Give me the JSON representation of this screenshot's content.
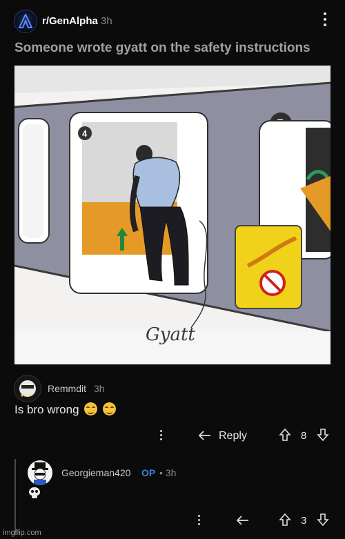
{
  "post": {
    "subreddit": "r/GenAlpha",
    "age": "3h",
    "title": "Someone wrote gyatt on the safety instructions",
    "image_handwriting": "Gyatt",
    "panel_numbers": [
      "4",
      "5"
    ]
  },
  "comments": [
    {
      "author": "Remmdit",
      "age": "3h",
      "body": "Is bro wrong",
      "emojis": [
        "relieved-face",
        "relieved-face"
      ],
      "reply_label": "Reply",
      "votes": "8"
    },
    {
      "author": "Georgieman420",
      "op_badge": "OP",
      "age_label": "• 3h",
      "body_emoji": "skull",
      "votes": "3"
    }
  ],
  "watermark": "imgflip.com",
  "colors": {
    "background": "#0b0b0b",
    "op_badge": "#3b82e0",
    "text": "#e8e8e8"
  }
}
